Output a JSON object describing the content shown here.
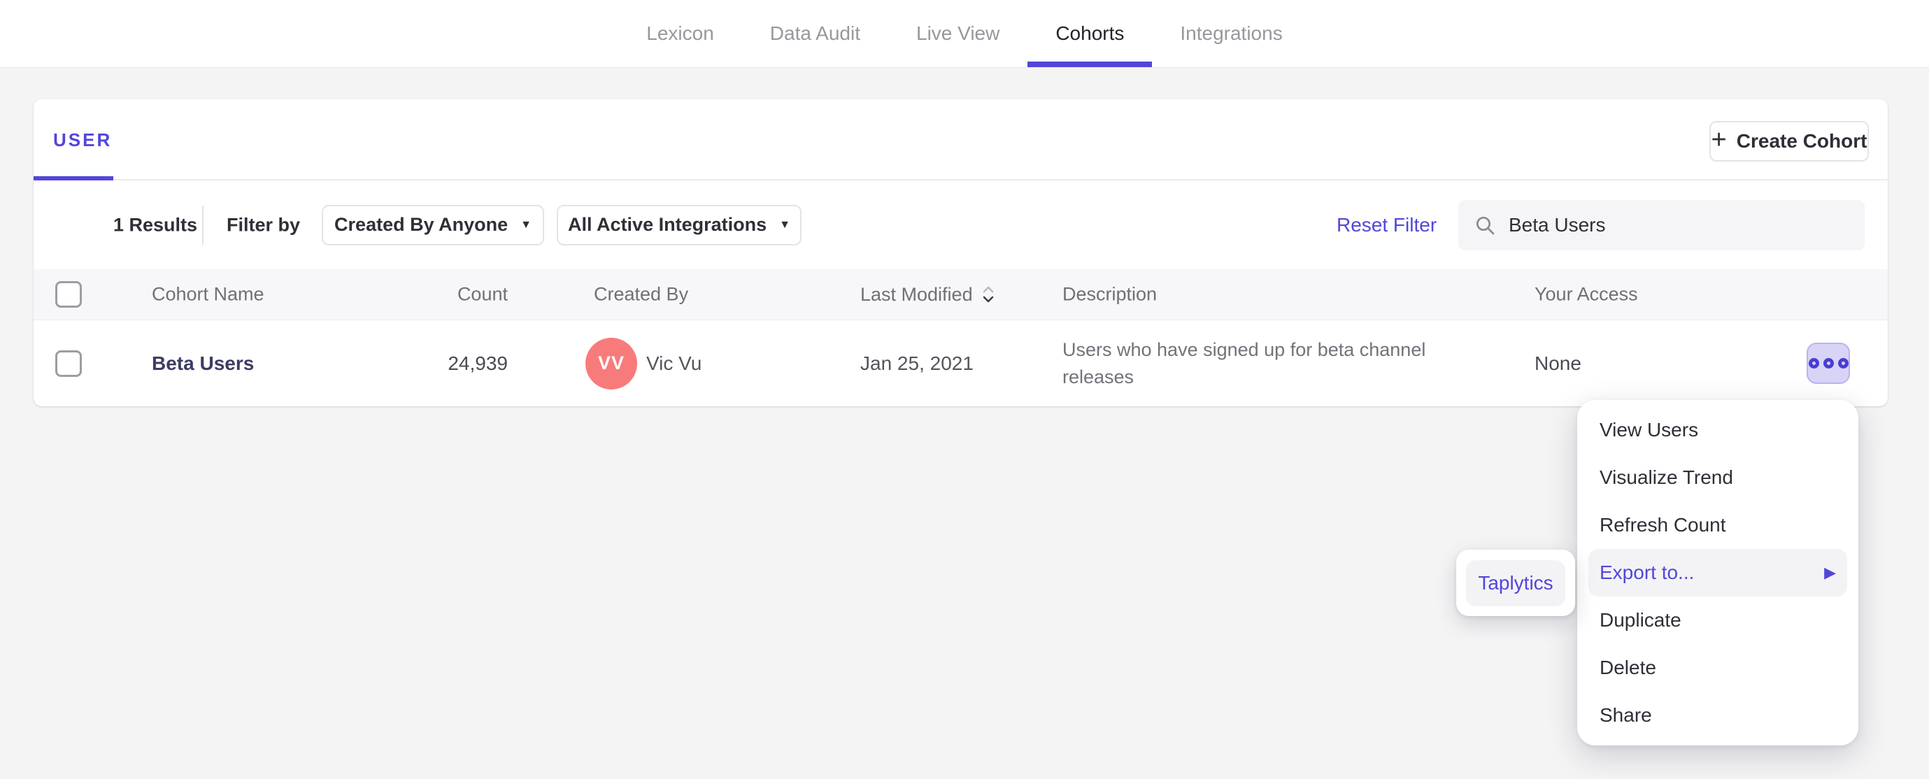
{
  "nav": {
    "items": [
      {
        "label": "Lexicon"
      },
      {
        "label": "Data Audit"
      },
      {
        "label": "Live View"
      },
      {
        "label": "Cohorts"
      },
      {
        "label": "Integrations"
      }
    ],
    "active_item": "Cohorts"
  },
  "panel": {
    "tab_label": "USER",
    "create_cohort_button": "Create Cohort",
    "create_cohort_plus": "+",
    "toolbar": {
      "results": "1 Results",
      "filter_by": "Filter by",
      "created_by_dropdown": "Created By Anyone",
      "integrations_dropdown": "All Active Integrations",
      "dropdown_caret": "▼",
      "reset_filter": "Reset Filter",
      "search_value": "Beta Users"
    },
    "table": {
      "headers": {
        "name": "Cohort Name",
        "count": "Count",
        "created_by": "Created By",
        "last_modified": "Last Modified",
        "description": "Description",
        "your_access": "Your Access"
      },
      "rows": [
        {
          "name": "Beta Users",
          "count": "24,939",
          "avatar_initials": "VV",
          "created_by": "Vic Vu",
          "last_modified": "Jan 25, 2021",
          "description": "Users who have signed up for beta channel releases",
          "your_access": "None"
        }
      ]
    }
  },
  "context_menu": {
    "items": [
      {
        "label": "View Users"
      },
      {
        "label": "Visualize Trend"
      },
      {
        "label": "Refresh Count"
      },
      {
        "label": "Export to...",
        "highlighted": true,
        "has_submenu": true,
        "arrow": "▶"
      },
      {
        "label": "Duplicate"
      },
      {
        "label": "Delete"
      },
      {
        "label": "Share"
      }
    ]
  },
  "export_submenu": {
    "items": [
      {
        "label": "Taplytics"
      }
    ]
  },
  "colors": {
    "accent_purple": "#5246d9",
    "avatar_red": "#f87b7b",
    "row_name_text": "#3d3c64",
    "actions_button_bg": "#d8d4f6",
    "menu_highlight_bg": "#f3f3f6",
    "page_bg": "#f4f4f5"
  }
}
